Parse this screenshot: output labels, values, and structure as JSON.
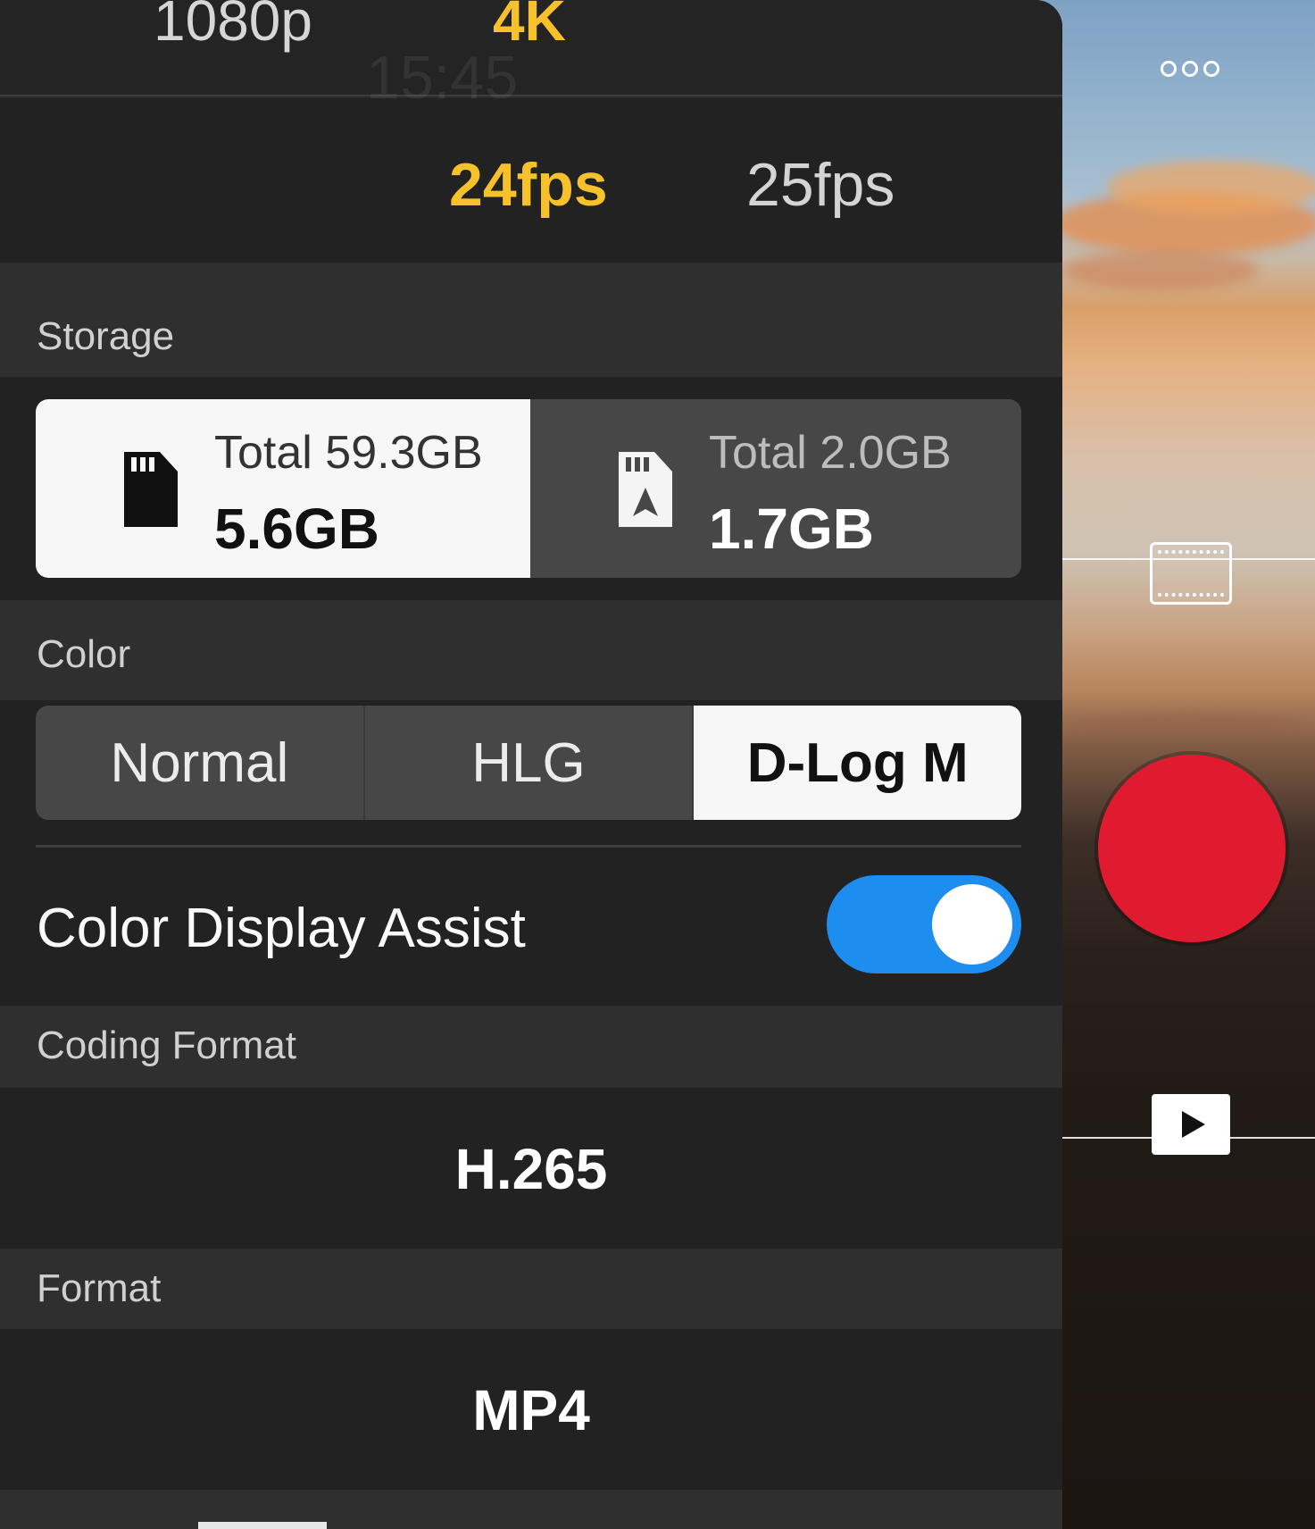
{
  "resolution": {
    "options": [
      "1080p",
      "4K"
    ],
    "selected": "4K"
  },
  "overlay_time": "15:45",
  "frame_rate": {
    "options": [
      "24fps",
      "25fps"
    ],
    "selected": "24fps"
  },
  "storage": {
    "label": "Storage",
    "cards": [
      {
        "name": "sd-card",
        "total": "Total 59.3GB",
        "free": "5.6GB",
        "selected": true
      },
      {
        "name": "internal-storage",
        "total": "Total 2.0GB",
        "free": "1.7GB",
        "selected": false
      }
    ]
  },
  "color": {
    "label": "Color",
    "options": [
      "Normal",
      "HLG",
      "D-Log M"
    ],
    "selected": "D-Log M",
    "display_assist": {
      "label": "Color Display Assist",
      "enabled": true
    }
  },
  "coding_format": {
    "label": "Coding Format",
    "value": "H.265"
  },
  "format": {
    "label": "Format",
    "value": "MP4"
  },
  "viewfinder": {
    "icons": [
      "more-icon",
      "film-frame-icon",
      "record-button",
      "play-icon"
    ],
    "record_color": "#e11b2f"
  },
  "accent_colors": {
    "selected_text": "#f6c12b",
    "toggle_on": "#1e8df0"
  }
}
